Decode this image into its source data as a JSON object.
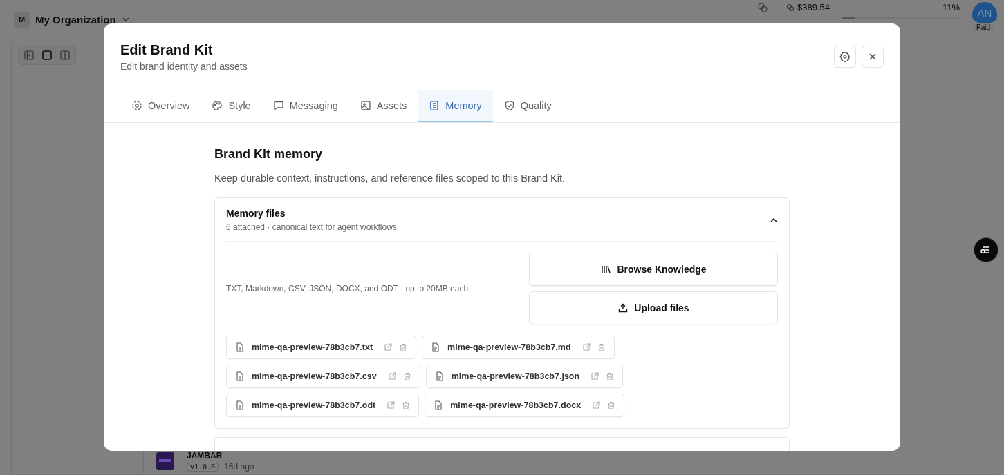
{
  "background": {
    "org": {
      "initial": "M",
      "name": "My Organization"
    },
    "balance": "$389.54",
    "usage": {
      "reading": "11%",
      "level": 0.11
    },
    "avatar": {
      "initials": "AN",
      "badge": "Paid"
    },
    "list_item": {
      "name": "JAMBAR",
      "version": "v1.0.0",
      "age": "16d ago"
    }
  },
  "modal": {
    "title": "Edit Brand Kit",
    "subtitle": "Edit brand identity and assets",
    "tabs": [
      {
        "label": "Overview",
        "selected": false
      },
      {
        "label": "Style",
        "selected": false
      },
      {
        "label": "Messaging",
        "selected": false
      },
      {
        "label": "Assets",
        "selected": false
      },
      {
        "label": "Memory",
        "selected": true
      },
      {
        "label": "Quality",
        "selected": false
      }
    ],
    "section": {
      "title": "Brand Kit memory",
      "description": "Keep durable context, instructions, and reference files scoped to this Brand Kit."
    },
    "memory_files": {
      "title": "Memory files",
      "summary": "6 attached · canonical text for agent workflows",
      "expanded": true,
      "hint": "TXT, Markdown, CSV, JSON, DOCX, and ODT · up to 20MB each",
      "actions": [
        "Browse Knowledge",
        "Upload files"
      ],
      "files": [
        "mime-qa-preview-78b3cb7.txt",
        "mime-qa-preview-78b3cb7.md",
        "mime-qa-preview-78b3cb7.csv",
        "mime-qa-preview-78b3cb7.json",
        "mime-qa-preview-78b3cb7.odt",
        "mime-qa-preview-78b3cb7.docx"
      ]
    }
  }
}
